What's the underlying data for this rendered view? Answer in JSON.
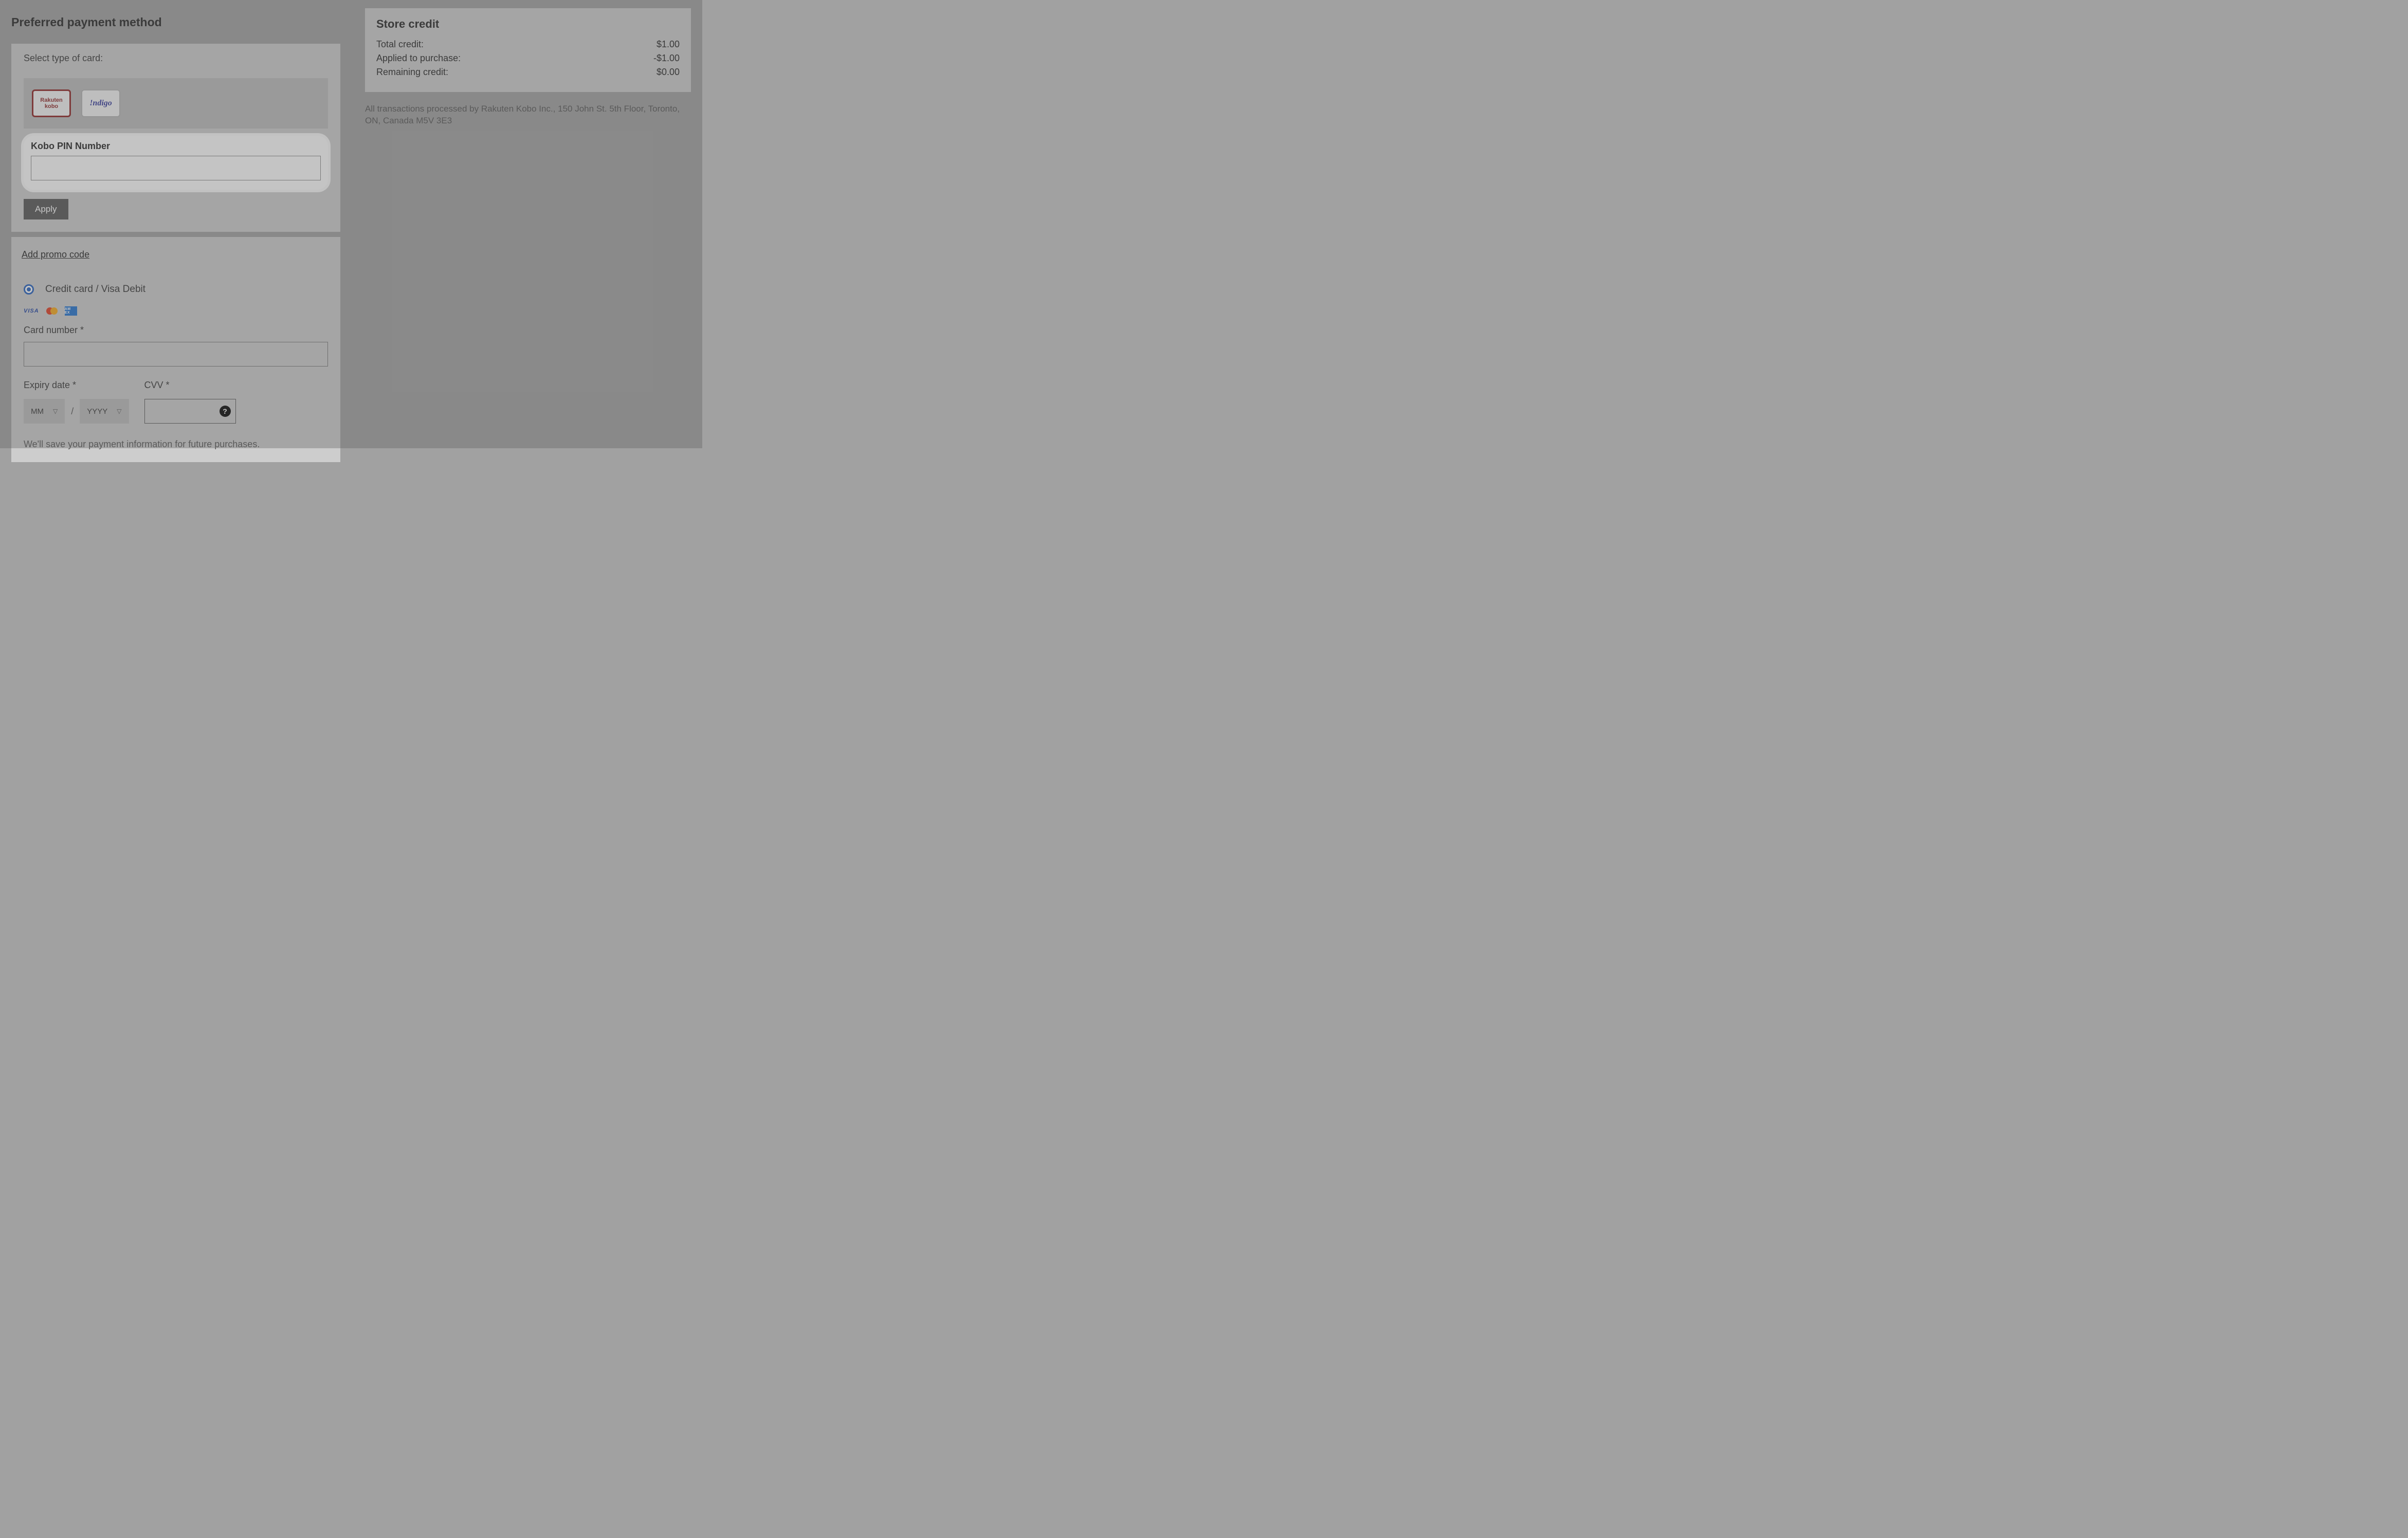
{
  "leftHeader": "Preferred payment method",
  "selectCardLabel": "Select type of card:",
  "cards": {
    "kobo": "Rakuten\nkobo",
    "indigo": "!ndigo"
  },
  "pin": {
    "label": "Kobo PIN Number",
    "value": ""
  },
  "applyLabel": "Apply",
  "promoLink": "Add promo code",
  "cc": {
    "radioLabel": "Credit card / Visa Debit",
    "cardNumberLabel": "Card number *",
    "expiryLabel": "Expiry date *",
    "cvvLabel": "CVV *",
    "mm": "MM",
    "yyyy": "YYYY",
    "sep": "/",
    "saveNote": "We'll save your payment information for future purchases."
  },
  "brands": {
    "visa": "VISA",
    "amex": "AM EX"
  },
  "storeCredit": {
    "title": "Store credit",
    "rows": [
      {
        "label": "Total credit:",
        "value": "$1.00"
      },
      {
        "label": "Applied to purchase:",
        "value": "-$1.00"
      },
      {
        "label": "Remaining credit:",
        "value": "$0.00"
      }
    ]
  },
  "disclaimer": "All transactions processed by Rakuten Kobo Inc., 150 John St. 5th Floor, Toronto, ON, Canada M5V 3E3"
}
